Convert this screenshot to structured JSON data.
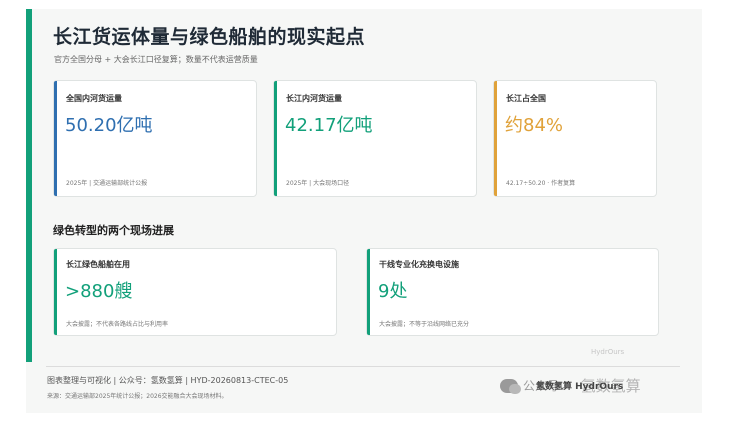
{
  "header": {
    "title": "长江货运体量与绿色船舶的现实起点",
    "subtitle": "官方全国分母 + 大会长江口径复算；数量不代表运营质量"
  },
  "stats": [
    {
      "label": "全国内河货运量",
      "value": "50.20亿吨",
      "note": "2025年 | 交通运输部统计公报",
      "color": "#2f6fb0"
    },
    {
      "label": "长江内河货运量",
      "value": "42.17亿吨",
      "note": "2025年 | 大会现场口径",
      "color": "#12a07a"
    },
    {
      "label": "长江占全国",
      "value": "约84%",
      "note": "42.17÷50.20 · 作者复算",
      "color": "#e0a23a"
    }
  ],
  "section": {
    "title": "绿色转型的两个现场进展"
  },
  "progress": [
    {
      "label": "长江绿色船舶在用",
      "value": ">880艘",
      "note": "大会披露；不代表各路线占比与利用率",
      "color": "#12a07a"
    },
    {
      "label": "干线专业化充换电设施",
      "value": "9处",
      "note": "大会披露；不等于沿线网络已充分",
      "color": "#12a07a"
    }
  ],
  "footer": {
    "line1": "图表整理与可视化 | 公众号：氢数氢算 | HYD-20260813-CTEC-05",
    "line2": "来源：交通运输部2025年统计公报；2026交能融合大会现场材料。"
  },
  "watermark": {
    "small": "HydrOurs",
    "prefix": "公众号 ·",
    "brand": "氢数氢算 HydrOurs",
    "large": "氢数氢算"
  }
}
